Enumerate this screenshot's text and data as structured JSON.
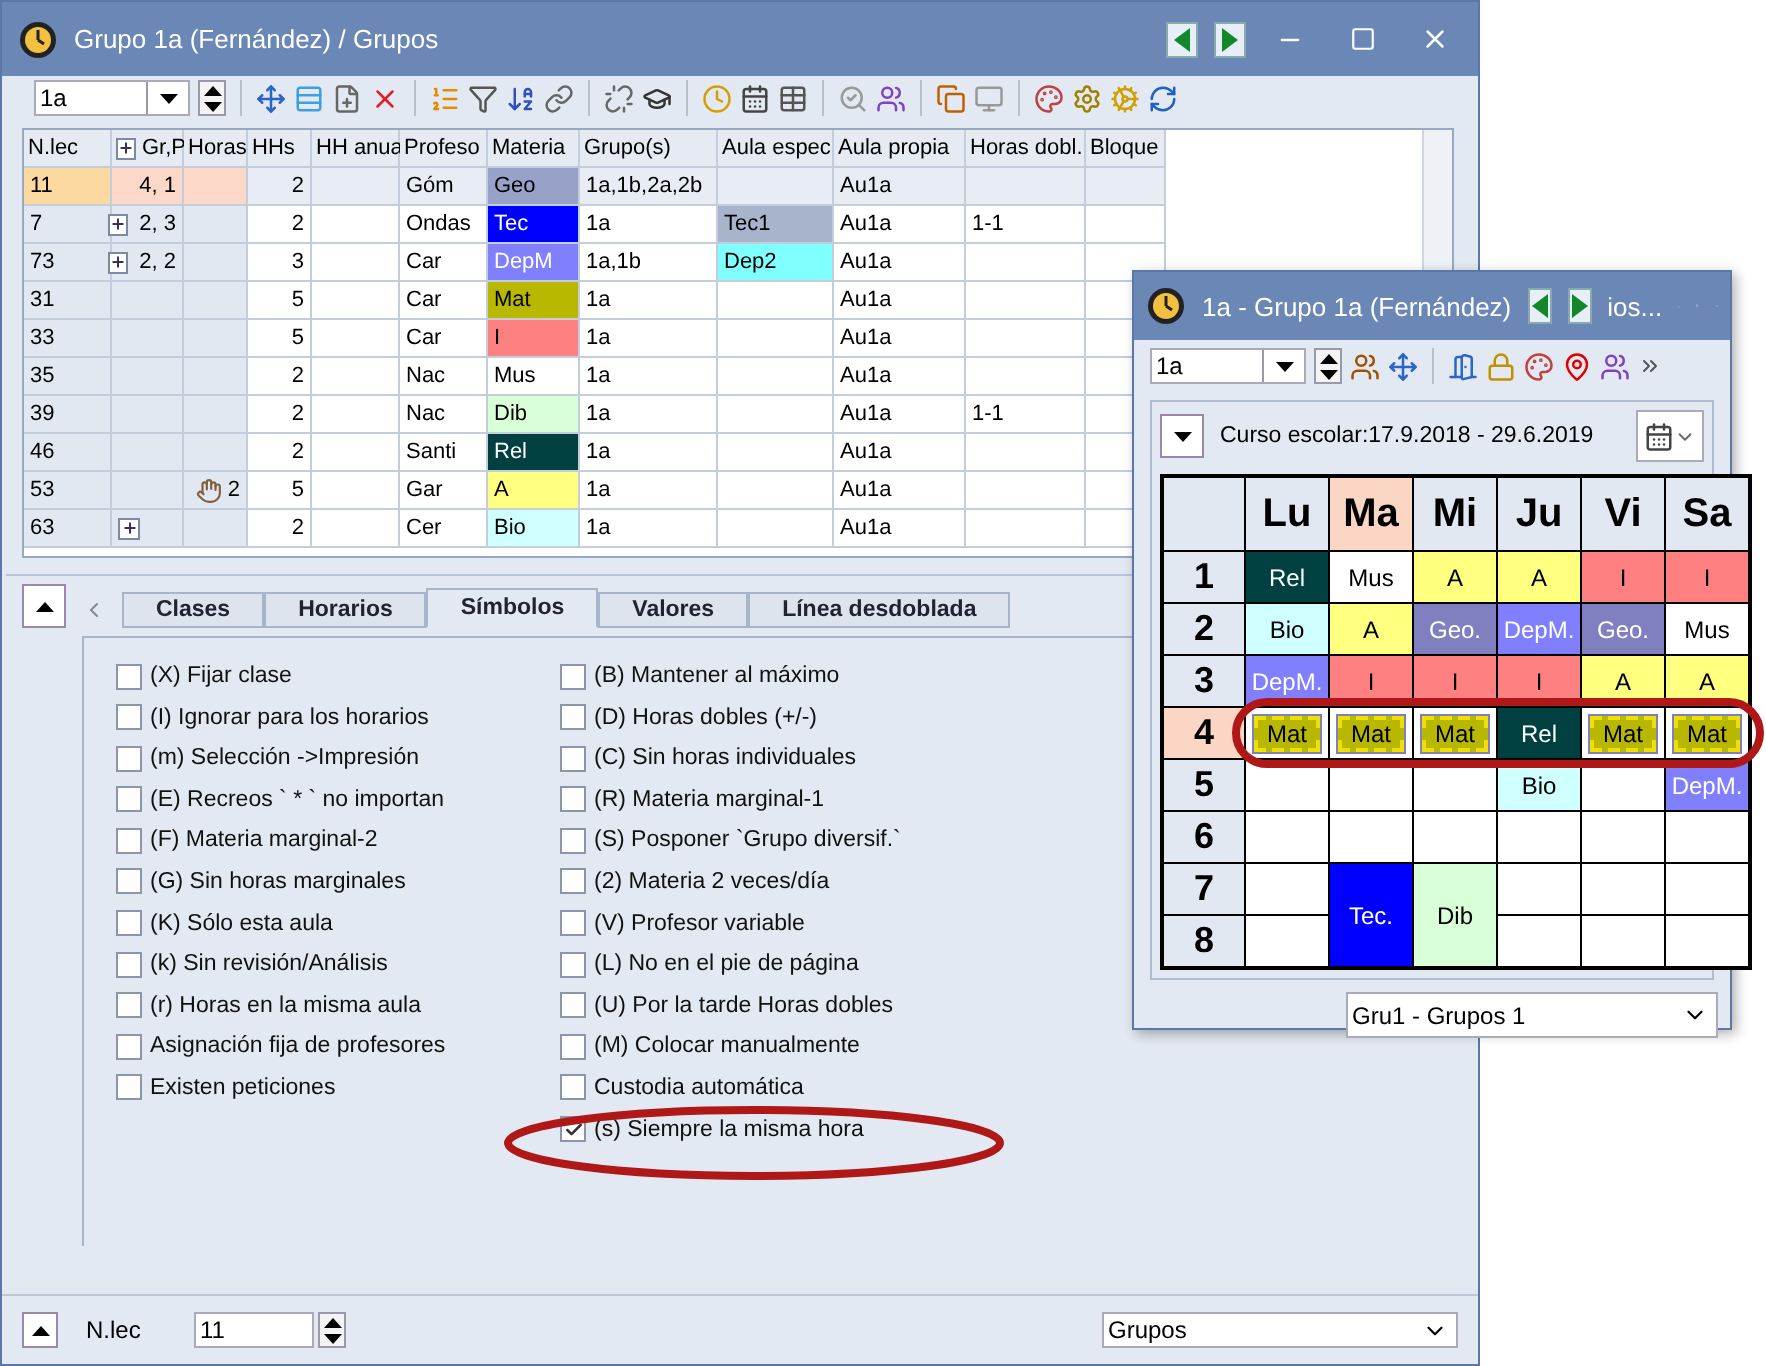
{
  "main_window": {
    "title": "Grupo 1a (Fernández) / Grupos",
    "selector": "1a",
    "table": {
      "columns": [
        "N.lec",
        "Gr,P",
        "Horas",
        "HHs",
        "HH anua",
        "Profeso",
        "Materia",
        "Grupo(s)",
        "Aula espec",
        "Aula propia",
        "Horas dobl.",
        "Bloque"
      ],
      "rows": [
        {
          "selected": true,
          "expandable": false,
          "fixed": false,
          "cells": [
            "11",
            "4, 1",
            "",
            "2",
            "",
            "Góm",
            {
              "text": "Geo",
              "color": "#98a2c8"
            },
            "1a,1b,2a,2b",
            "",
            "Au1a",
            "",
            ""
          ]
        },
        {
          "selected": false,
          "expandable": true,
          "fixed": false,
          "cells": [
            "7",
            "2, 3",
            "",
            "2",
            "",
            "Ondas",
            {
              "text": "Tec",
              "color": "#0000ff"
            },
            "1a",
            {
              "text": "Tec1",
              "color": "#a8b4cc"
            },
            "Au1a",
            "1-1",
            ""
          ]
        },
        {
          "selected": false,
          "expandable": true,
          "fixed": false,
          "cells": [
            "73",
            "2, 2",
            "",
            "3",
            "",
            "Car",
            {
              "text": "DepM",
              "color": "#8080ff"
            },
            "1a,1b",
            {
              "text": "Dep2",
              "color": "#80ffff"
            },
            "Au1a",
            "",
            ""
          ]
        },
        {
          "selected": false,
          "expandable": false,
          "fixed": false,
          "cells": [
            "31",
            "",
            "",
            "5",
            "",
            "Car",
            {
              "text": "Mat",
              "color": "#b8b800"
            },
            "1a",
            "",
            "Au1a",
            "",
            ""
          ]
        },
        {
          "selected": false,
          "expandable": false,
          "fixed": false,
          "cells": [
            "33",
            "",
            "",
            "5",
            "",
            "Car",
            {
              "text": "I",
              "color": "#ff8080"
            },
            "1a",
            "",
            "Au1a",
            "",
            ""
          ]
        },
        {
          "selected": false,
          "expandable": false,
          "fixed": false,
          "cells": [
            "35",
            "",
            "",
            "2",
            "",
            "Nac",
            {
              "text": "Mus",
              "color": "#ffffff"
            },
            "1a",
            "",
            "Au1a",
            "",
            ""
          ]
        },
        {
          "selected": false,
          "expandable": false,
          "fixed": false,
          "cells": [
            "39",
            "",
            "",
            "2",
            "",
            "Nac",
            {
              "text": "Dib",
              "color": "#d8ffd8"
            },
            "1a",
            "",
            "Au1a",
            "1-1",
            ""
          ]
        },
        {
          "selected": false,
          "expandable": false,
          "fixed": false,
          "cells": [
            "46",
            "",
            "",
            "2",
            "",
            "Santi",
            {
              "text": "Rel",
              "color": "#004040"
            },
            "1a",
            "",
            "Au1a",
            "",
            ""
          ]
        },
        {
          "selected": false,
          "expandable": false,
          "fixed": true,
          "cells": [
            "53",
            "",
            "2",
            "5",
            "",
            "Gar",
            {
              "text": "A",
              "color": "#ffff80"
            },
            "1a",
            "",
            "Au1a",
            "",
            ""
          ]
        },
        {
          "selected": false,
          "expandable": true,
          "fixed": false,
          "cells": [
            "63",
            "",
            "",
            "2",
            "",
            "Cer",
            {
              "text": "Bio",
              "color": "#d0ffff"
            },
            "1a",
            "",
            "Au1a",
            "",
            ""
          ]
        }
      ]
    },
    "tabs": [
      {
        "label": "Clases",
        "selected": false
      },
      {
        "label": "Horarios",
        "selected": false
      },
      {
        "label": "Símbolos",
        "selected": true
      },
      {
        "label": "Valores",
        "selected": false
      },
      {
        "label": "Línea desdoblada",
        "selected": false
      }
    ],
    "options_left": [
      {
        "label": "(X) Fijar clase",
        "checked": false
      },
      {
        "label": "(I) Ignorar para los horarios",
        "checked": false
      },
      {
        "label": "(m) Selección ->Impresión",
        "checked": false
      },
      {
        "label": "(E) Recreos ` * ` no importan",
        "checked": false
      },
      {
        "label": "(F) Materia marginal-2",
        "checked": false
      },
      {
        "label": "(G) Sin horas marginales",
        "checked": false
      },
      {
        "label": "(K) Sólo esta aula",
        "checked": false
      },
      {
        "label": "(k) Sin revisión/Análisis",
        "checked": false
      },
      {
        "label": "(r) Horas en la misma aula",
        "checked": false
      },
      {
        "label": "Asignación fija de profesores",
        "checked": false
      },
      {
        "label": "Existen peticiones",
        "checked": false
      }
    ],
    "options_right": [
      {
        "label": "(B) Mantener al máximo",
        "checked": false
      },
      {
        "label": "(D) Horas dobles (+/-)",
        "checked": false
      },
      {
        "label": "(C) Sin horas individuales",
        "checked": false
      },
      {
        "label": "(R) Materia marginal-1",
        "checked": false
      },
      {
        "label": "(S) Posponer `Grupo diversif.`",
        "checked": false
      },
      {
        "label": "(2) Materia 2 veces/día",
        "checked": false
      },
      {
        "label": "(V) Profesor variable",
        "checked": false
      },
      {
        "label": "(L) No en el pie de página",
        "checked": false
      },
      {
        "label": "(U) Por la tarde Horas dobles",
        "checked": false
      },
      {
        "label": "(M) Colocar manualmente",
        "checked": false
      },
      {
        "label": "Custodia automática",
        "checked": false
      },
      {
        "label": "(s) Siempre la misma hora",
        "checked": true
      }
    ],
    "record_label": "N.lec",
    "record_value": "11",
    "view_select": "Grupos"
  },
  "timetable_window": {
    "title": "1a - Grupo 1a (Fernández)",
    "title_tail": "ios...",
    "selector": "1a",
    "school_year": "Curso escolar:17.9.2018 - 29.6.2019",
    "days": [
      {
        "label": "Lu",
        "selected": false
      },
      {
        "label": "Ma",
        "selected": true
      },
      {
        "label": "Mi",
        "selected": false
      },
      {
        "label": "Ju",
        "selected": false
      },
      {
        "label": "Vi",
        "selected": false
      },
      {
        "label": "Sa",
        "selected": false
      }
    ],
    "periods": [
      {
        "label": "1",
        "selected": false,
        "cells": [
          {
            "text": "Rel",
            "color": "#004040",
            "selected": false,
            "kind": "single"
          },
          {
            "text": "Mus",
            "color": "#ffffff",
            "selected": false,
            "kind": "single"
          },
          {
            "text": "A",
            "color": "#ffff80",
            "selected": false,
            "kind": "single"
          },
          {
            "text": "A",
            "color": "#ffff80",
            "selected": false,
            "kind": "single"
          },
          {
            "text": "I",
            "color": "#ff8080",
            "selected": false,
            "kind": "single"
          },
          {
            "text": "I",
            "color": "#ff8080",
            "selected": false,
            "kind": "single"
          }
        ]
      },
      {
        "label": "2",
        "selected": false,
        "cells": [
          {
            "text": "Bio",
            "color": "#d0ffff",
            "selected": false,
            "kind": "single"
          },
          {
            "text": "A",
            "color": "#ffff80",
            "selected": false,
            "kind": "single"
          },
          {
            "text": "Geo.",
            "color": "#8080c0",
            "selected": false,
            "kind": "single"
          },
          {
            "text": "DepM.",
            "color": "#8080ff",
            "selected": false,
            "kind": "single"
          },
          {
            "text": "Geo.",
            "color": "#8080c0",
            "selected": false,
            "kind": "single"
          },
          {
            "text": "Mus",
            "color": "#ffffff",
            "selected": false,
            "kind": "single"
          }
        ]
      },
      {
        "label": "3",
        "selected": false,
        "cells": [
          {
            "text": "DepM.",
            "color": "#8080ff",
            "selected": false,
            "kind": "single"
          },
          {
            "text": "I",
            "color": "#ff8080",
            "selected": false,
            "kind": "single"
          },
          {
            "text": "I",
            "color": "#ff8080",
            "selected": false,
            "kind": "single"
          },
          {
            "text": "I",
            "color": "#ff8080",
            "selected": false,
            "kind": "single"
          },
          {
            "text": "A",
            "color": "#ffff80",
            "selected": false,
            "kind": "single"
          },
          {
            "text": "A",
            "color": "#ffff80",
            "selected": false,
            "kind": "single"
          }
        ]
      },
      {
        "label": "4",
        "selected": true,
        "cells": [
          {
            "text": "Mat",
            "color": "#b8b800",
            "selected": true,
            "kind": "single"
          },
          {
            "text": "Mat",
            "color": "#b8b800",
            "selected": true,
            "kind": "single"
          },
          {
            "text": "Mat",
            "color": "#b8b800",
            "selected": true,
            "kind": "single"
          },
          {
            "text": "Rel",
            "color": "#004040",
            "selected": false,
            "kind": "single"
          },
          {
            "text": "Mat",
            "color": "#b8b800",
            "selected": true,
            "kind": "single"
          },
          {
            "text": "Mat",
            "color": "#b8b800",
            "selected": true,
            "kind": "single"
          }
        ]
      },
      {
        "label": "5",
        "selected": false,
        "cells": [
          {
            "color": "#ffffff",
            "selected": false,
            "kind": "single"
          },
          {
            "color": "#ffffff",
            "selected": false,
            "kind": "single"
          },
          {
            "color": "#ffffff",
            "selected": false,
            "kind": "single"
          },
          {
            "text": "Bio",
            "color": "#d0ffff",
            "selected": false,
            "kind": "single"
          },
          {
            "color": "#ffffff",
            "selected": false,
            "kind": "single"
          },
          {
            "text": "DepM.",
            "color": "#8080ff",
            "selected": false,
            "kind": "single"
          }
        ]
      },
      {
        "label": "6",
        "selected": false,
        "cells": [
          {
            "color": "#ffffff",
            "selected": false,
            "kind": "single"
          },
          {
            "color": "#ffffff",
            "selected": false,
            "kind": "single"
          },
          {
            "color": "#ffffff",
            "selected": false,
            "kind": "single"
          },
          {
            "color": "#ffffff",
            "selected": false,
            "kind": "single"
          },
          {
            "color": "#ffffff",
            "selected": false,
            "kind": "single"
          },
          {
            "color": "#ffffff",
            "selected": false,
            "kind": "single"
          }
        ]
      },
      {
        "label": "7",
        "selected": false,
        "cells": [
          {
            "color": "#ffffff",
            "selected": false,
            "kind": "single"
          },
          {
            "text": "Tec.",
            "color": "#0000ff",
            "selected": false,
            "kind": "double"
          },
          {
            "text": "Dib",
            "color": "#d8ffd8",
            "selected": false,
            "kind": "double"
          },
          {
            "color": "#ffffff",
            "selected": false,
            "kind": "single"
          },
          {
            "color": "#ffffff",
            "selected": false,
            "kind": "single"
          },
          {
            "color": "#ffffff",
            "selected": false,
            "kind": "single"
          }
        ]
      },
      {
        "label": "8",
        "selected": false,
        "cells": [
          {
            "color": "#ffffff",
            "selected": false,
            "kind": "single"
          },
          {
            "color": "#ffffff",
            "selected": false,
            "kind": "single"
          },
          {
            "color": "#ffffff",
            "selected": false,
            "kind": "single"
          },
          {
            "color": "#ffffff",
            "selected": false,
            "kind": "single"
          }
        ]
      }
    ],
    "footer_select": "Gru1 - Grupos 1"
  }
}
